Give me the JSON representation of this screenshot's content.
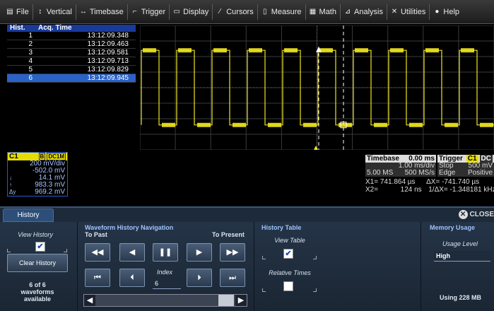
{
  "menu": [
    {
      "icon": "file-icon",
      "glyph": "▤",
      "label": "File"
    },
    {
      "icon": "vertical-icon",
      "glyph": "↕",
      "label": "Vertical"
    },
    {
      "icon": "timebase-icon",
      "glyph": "↔",
      "label": "Timebase"
    },
    {
      "icon": "trigger-icon",
      "glyph": "⌐",
      "label": "Trigger"
    },
    {
      "icon": "display-icon",
      "glyph": "▭",
      "label": "Display"
    },
    {
      "icon": "cursors-icon",
      "glyph": "⁄",
      "label": "Cursors"
    },
    {
      "icon": "measure-icon",
      "glyph": "▯",
      "label": "Measure"
    },
    {
      "icon": "math-icon",
      "glyph": "▦",
      "label": "Math"
    },
    {
      "icon": "analysis-icon",
      "glyph": "⊿",
      "label": "Analysis"
    },
    {
      "icon": "utilities-icon",
      "glyph": "✕",
      "label": "Utilities"
    },
    {
      "icon": "help-icon",
      "glyph": "●",
      "label": "Help"
    }
  ],
  "history_table": {
    "headers": [
      "Hist.",
      "Acq. Time"
    ],
    "rows": [
      {
        "n": "1",
        "t": "13:12:09.348"
      },
      {
        "n": "2",
        "t": "13:12:09.463"
      },
      {
        "n": "3",
        "t": "13:12:09.581"
      },
      {
        "n": "4",
        "t": "13:12:09.713"
      },
      {
        "n": "5",
        "t": "13:12:09.829"
      },
      {
        "n": "6",
        "t": "13:12:09.945"
      }
    ],
    "selected_index": 5
  },
  "waveform": {
    "channel_label": "C1",
    "trace_color": "#f0e61e",
    "high_level": 0.2,
    "low_level": 0.8
  },
  "channel_box": {
    "channel": "C1",
    "badge_b": "B",
    "coupling": "DC1M",
    "vdiv": "200 mV/div",
    "offset": "-502.0 mV",
    "rows": [
      {
        "label": "↓",
        "value": "14.1 mV"
      },
      {
        "label": "↑",
        "value": "983.3 mV"
      },
      {
        "label": "Δy",
        "value": "969.2 mV"
      }
    ],
    "header_color": "#e8dd00"
  },
  "timebase": {
    "title": "Timebase",
    "value": "0.00 ms",
    "div": "1.00 ms/div",
    "samples": "5.00 MS",
    "rate": "500 MS/s"
  },
  "trigger": {
    "title": "Trigger",
    "ch": "C1",
    "coupling": "DC",
    "mode": "Stop",
    "level": "500 mV",
    "type": "Edge",
    "slope": "Positive"
  },
  "cursors": {
    "x1_label": "X1=",
    "x1": "741.864 µs",
    "dx_label": "ΔX=",
    "dx": "-741.740 µs",
    "x2_label": "X2=",
    "x2": "124 ns",
    "idx_label": "1/ΔX=",
    "idx": "-1.348181 kHz"
  },
  "panel": {
    "tab": "History",
    "close": "CLOSE",
    "view_history": "View History",
    "clear_history": "Clear History",
    "status_line1": "6 of 6",
    "status_line2": "waveforms",
    "status_line3": "available",
    "nav_title": "Waveform History Navigation",
    "to_past": "To Past",
    "to_present": "To Present",
    "index_label": "Index",
    "index_value": "6",
    "table_title": "History Table",
    "view_table": "View Table",
    "relative_times": "Relative Times",
    "memory_title": "Memory Usage",
    "usage_level_label": "Usage Level",
    "usage_level": "High",
    "using": "Using 228 MB"
  },
  "colors": {
    "menubar": "#2a2a2a",
    "accent": "#2a62c8",
    "panel": "#243447",
    "trace": "#f0e61e"
  }
}
